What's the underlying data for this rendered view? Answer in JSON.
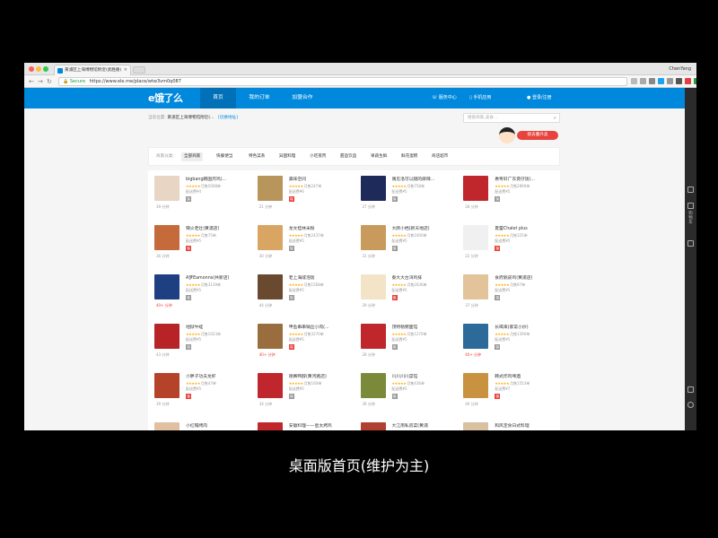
{
  "browser": {
    "tab_title": "黄浦区上海博物馆附近(武胜路)",
    "profile_name": "ChenYang",
    "url_secure_label": "Secure",
    "url": "https://www.ele.me/place/wtw3vm0q087"
  },
  "header": {
    "logo": "e饿了么",
    "nav": [
      {
        "label": "首页"
      },
      {
        "label": "我的订单"
      },
      {
        "label": "加盟合作"
      }
    ],
    "service_center": "服务中心",
    "mobile_app": "手机应用",
    "login": "登录/注册"
  },
  "location": {
    "prefix": "当前位置:",
    "address": "黄浦区上海博物馆附近(...",
    "switch_label": "[切换地址]"
  },
  "search": {
    "placeholder": "搜索商家,美食..."
  },
  "mascot": {
    "tag": "接去叠外卖"
  },
  "filter": {
    "label": "商家分类:",
    "items": [
      "全部商家",
      "快餐便当",
      "特色菜系",
      "异国料理",
      "小吃夜宵",
      "甜品饮品",
      "果蔬生鲜",
      "鲜花蛋糕",
      "商店超市"
    ]
  },
  "shops": [
    {
      "name": "bigbang韩国炸鸡(...",
      "sales": "月售5008单",
      "fee": "配送费¥4",
      "time": "39 分钟",
      "badge": "保",
      "thumb": "#e8d5c4"
    },
    {
      "name": "美味空间",
      "sales": "月售247单",
      "fee": "配送费¥6",
      "time": "21 分钟",
      "badge": "保",
      "thumb": "#b8955a"
    },
    {
      "name": "偶见洛可以随的麻辣...",
      "sales": "月售758单",
      "fee": "配送费¥5",
      "time": "27 分钟",
      "badge": "保",
      "thumb": "#1e2a5a"
    },
    {
      "name": "惠粤轩广东煲仔饭(...",
      "sales": "月售2890单",
      "fee": "配送费¥5",
      "time": "28 分钟",
      "badge": "保",
      "thumb": "#c0272d"
    },
    {
      "name": "辣火老灶(黄浦店)",
      "sales": "月售75单",
      "fee": "配送费¥5",
      "time": "36 分钟",
      "badge": "保",
      "thumb": "#c56a3a"
    },
    {
      "name": "龙文桂林米粉",
      "sales": "月售2437单",
      "fee": "配送费¥5",
      "time": "30 分钟",
      "badge": "保",
      "thumb": "#d8a562"
    },
    {
      "name": "大牌小档(新天地店)",
      "sales": "月售1000单",
      "fee": "配送费¥5",
      "time": "31 分钟",
      "badge": "保",
      "thumb": "#c89a5c"
    },
    {
      "name": "夏蕾Chalet plus",
      "sales": "月售325单",
      "fee": "配送费¥5",
      "time": "22 分钟",
      "badge": "保",
      "thumb": "#f0f0f0"
    },
    {
      "name": "A梦Eamonns(共新店)",
      "sales": "月售3139单",
      "fee": "配送费¥5",
      "time": "40+ 分钟",
      "badge": "保",
      "thumb": "#1e3f82"
    },
    {
      "name": "老上海咸泡饭",
      "sales": "月售1568单",
      "fee": "配送费¥5",
      "time": "44 分钟",
      "badge": "保",
      "thumb": "#6a4a2e"
    },
    {
      "name": "秦大大台湾鸡排",
      "sales": "月售2036单",
      "fee": "配送费¥5",
      "time": "29 分钟",
      "badge": "保",
      "thumb": "#f3e4c8"
    },
    {
      "name": "食府鹅皮鸡(黄浦店)",
      "sales": "月售97单",
      "fee": "配送费¥5",
      "time": "37 分钟",
      "badge": "保",
      "thumb": "#e2c39a"
    },
    {
      "name": "地狱牛蛙",
      "sales": "月售1023单",
      "fee": "配送费¥5",
      "time": "43 分钟",
      "badge": "保",
      "thumb": "#b82328"
    },
    {
      "name": "甲鱼串串锅丝小肉(...",
      "sales": "月售3270单",
      "fee": "配送费¥5",
      "time": "40+ 分钟",
      "badge": "保",
      "thumb": "#9a6d3e"
    },
    {
      "name": "顶特勒粥面馆",
      "sales": "月售1270单",
      "fee": "配送费¥5",
      "time": "28 分钟",
      "badge": "保",
      "thumb": "#c0272d"
    },
    {
      "name": "长喝来(家常小炒)",
      "sales": "月售1390单",
      "fee": "配送费¥5",
      "time": "40+ 分钟",
      "badge": "保",
      "thumb": "#2c6a9a"
    },
    {
      "name": "小胖子功夫龙虾",
      "sales": "月售47单",
      "fee": "配送费¥5",
      "time": "39 分钟",
      "badge": "保",
      "thumb": "#b5432a"
    },
    {
      "name": "德赛鸭脖(黄河路店)",
      "sales": "月售160单",
      "fee": "配送费¥5",
      "time": "34 分钟",
      "badge": "保",
      "thumb": "#c0272d"
    },
    {
      "name": "川川川川菜馆",
      "sales": "月售436单",
      "fee": "配送费¥5",
      "time": "39 分钟",
      "badge": "保",
      "thumb": "#7a8a3a"
    },
    {
      "name": "韩式炸鸡啤酒",
      "sales": "月售1553单",
      "fee": "配送费¥7",
      "time": "40 分钟",
      "badge": "保",
      "thumb": "#c89240"
    },
    {
      "name": "小红帽烤肉",
      "sales": "",
      "fee": "",
      "time": "",
      "badge": "",
      "thumb": "#e0c0a0"
    },
    {
      "name": "安徽料理——皇太烤鸡",
      "sales": "",
      "fee": "",
      "time": "",
      "badge": "",
      "thumb": "#c0272d"
    },
    {
      "name": "大江南私房菜(黄浦",
      "sales": "",
      "fee": "",
      "time": "",
      "badge": "",
      "thumb": "#b04030"
    },
    {
      "name": "和风定食日式料理",
      "sales": "",
      "fee": "",
      "time": "",
      "badge": "",
      "thumb": "#d8c0a0"
    }
  ],
  "rightbar": {
    "text": "购物车"
  },
  "caption": "桌面版首页(维护为主)",
  "colors": {
    "brand_blue": "#0089dc",
    "star": "#ffaa0c",
    "hot": "#e8433c"
  }
}
